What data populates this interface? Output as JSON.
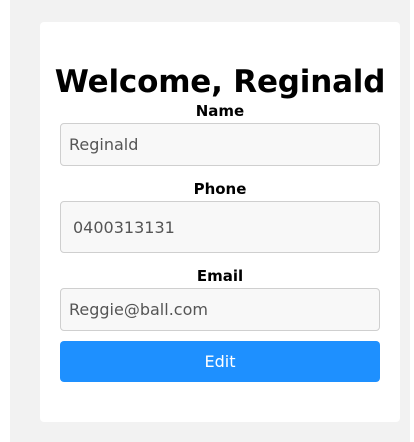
{
  "profile": {
    "heading": "Welcome, Reginald",
    "fields": {
      "name": {
        "label": "Name",
        "value": "Reginald"
      },
      "phone": {
        "label": "Phone",
        "value": "0400313131"
      },
      "email": {
        "label": "Email",
        "value": "Reggie@ball.com"
      }
    },
    "edit_label": "Edit"
  },
  "colors": {
    "accent": "#1e90ff",
    "page_bg": "#f2f2f2",
    "card_bg": "#ffffff"
  }
}
